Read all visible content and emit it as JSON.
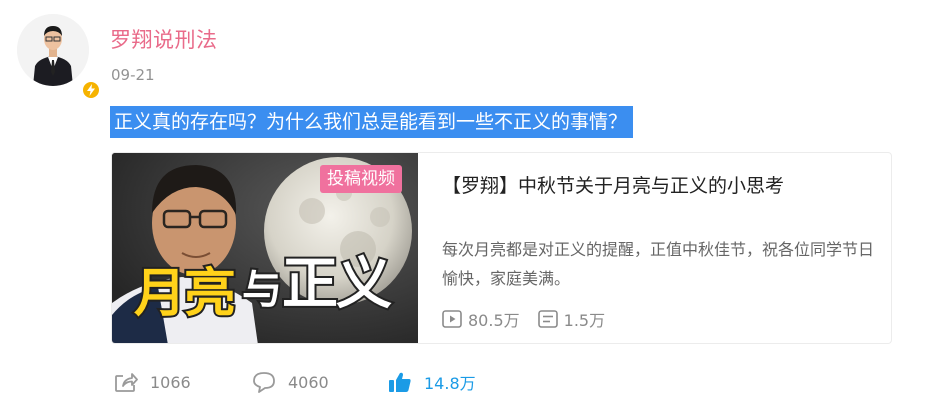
{
  "author": {
    "name": "罗翔说刑法",
    "avatar_icon": "author-avatar",
    "verified_icon": "lightning-badge-icon",
    "verified_color": "#f6b300"
  },
  "post": {
    "time": "09-21",
    "text": "正义真的存在吗？为什么我们总是能看到一些不正义的事情？",
    "highlight_color": "#3b8ef0"
  },
  "video_card": {
    "badge": "投稿视频",
    "thumb_text": "月亮与正义",
    "title": "【罗翔】中秋节关于月亮与正义的小思考",
    "description": "每次月亮都是对正义的提醒，正值中秋佳节，祝各位同学节日愉快，家庭美满。",
    "plays": "80.5万",
    "danmaku": "1.5万",
    "play_icon": "play-icon",
    "danmaku_icon": "danmaku-icon"
  },
  "actions": {
    "repost_count": "1066",
    "comment_count": "4060",
    "like_count": "14.8万",
    "like_color": "#1b9be6"
  }
}
